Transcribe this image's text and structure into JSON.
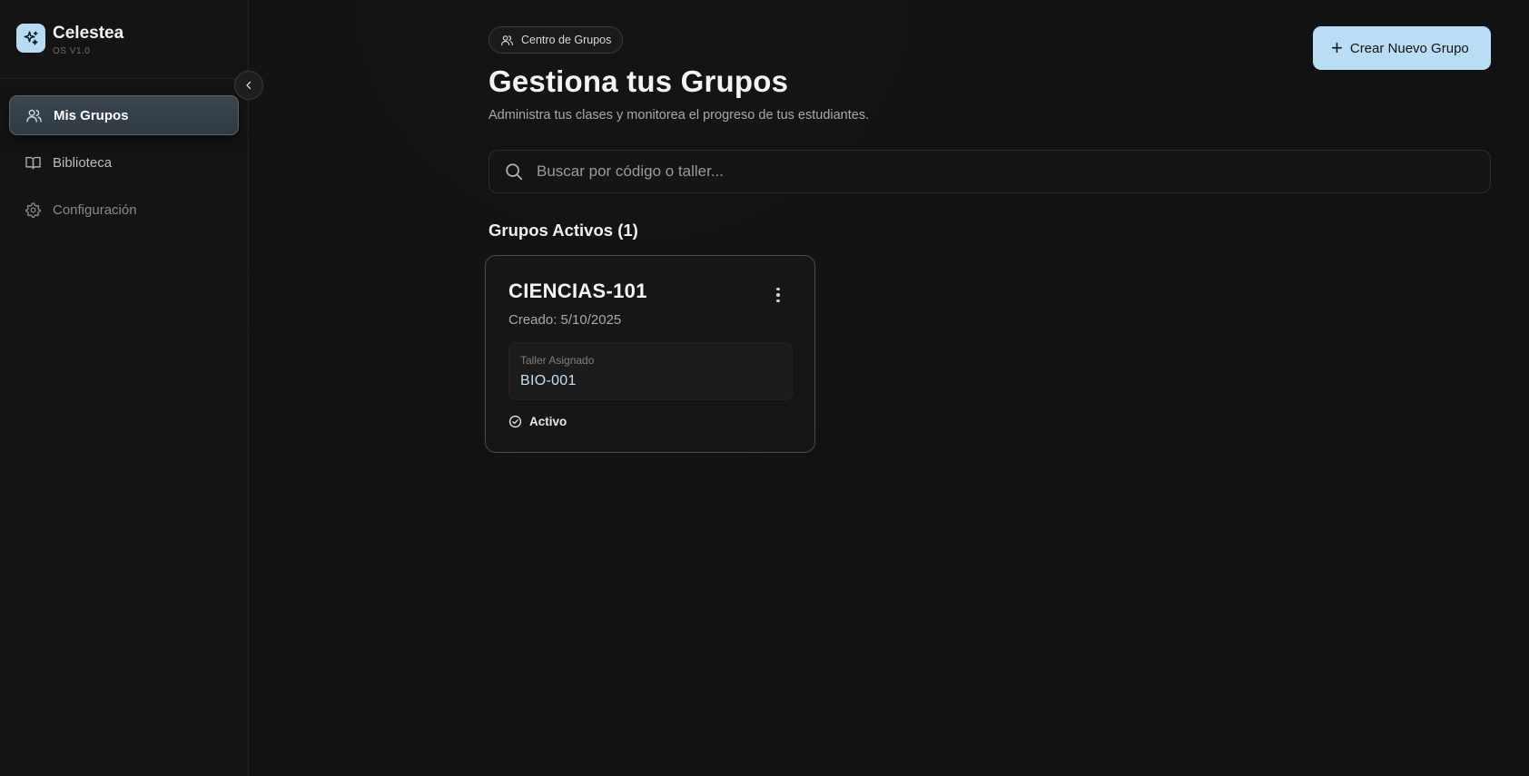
{
  "brand": {
    "name": "Celestea",
    "version": "OS V1.0"
  },
  "sidebar": {
    "items": [
      {
        "label": "Mis Grupos",
        "icon": "users-icon",
        "active": true
      },
      {
        "label": "Biblioteca",
        "icon": "book-icon",
        "active": false
      },
      {
        "label": "Configuración",
        "icon": "gear-icon",
        "active": false
      }
    ]
  },
  "header": {
    "pill_label": "Centro de Grupos",
    "title": "Gestiona tus Grupos",
    "subtitle": "Administra tus clases y monitorea el progreso de tus estudiantes.",
    "create_button_label": "Crear Nuevo Grupo"
  },
  "search": {
    "placeholder": "Buscar por código o taller...",
    "value": ""
  },
  "groups": {
    "section_title": "Grupos Activos (1)",
    "cards": [
      {
        "code": "CIENCIAS-101",
        "created": "Creado: 5/10/2025",
        "assigned_label": "Taller Asignado",
        "assigned_value": "BIO-001",
        "status": "Activo"
      }
    ]
  },
  "colors": {
    "accent": "#b9ddf5",
    "background": "#131313",
    "active_nav": "#36424b"
  }
}
